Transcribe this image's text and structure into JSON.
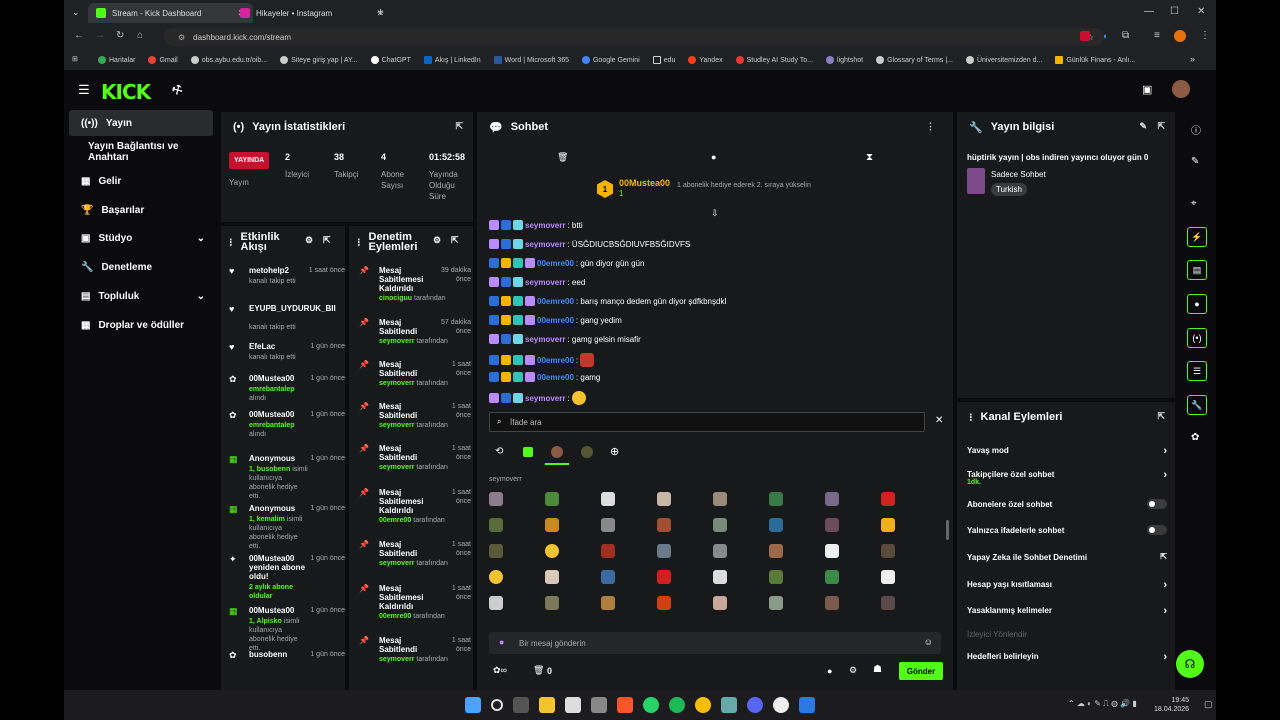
{
  "browser": {
    "tabs": [
      {
        "title": "Stream - Kick Dashboard",
        "active": true
      },
      {
        "title": "Hikayeler • Instagram",
        "active": false
      }
    ],
    "url": "dashboard.kick.com/stream",
    "bookmarks": [
      "Haritalar",
      "Gmail",
      "obs.aybu.edu.tr/oib...",
      "Siteye giriş yap | AY...",
      "ChatGPT",
      "Akış | LinkedIn",
      "Word | Microsoft 365",
      "Google Gemini",
      "edu",
      "Yandex",
      "Studley AI Study To...",
      "lightshot",
      "Glossary of Terms |...",
      "Üniversitemizden d...",
      "Günlük Finans - Anlı..."
    ]
  },
  "app": {
    "logo": "KICK",
    "sidebar": [
      {
        "label": "Yayın",
        "active": true
      },
      {
        "label": "Yayın Bağlantısı ve Anahtarı"
      },
      {
        "label": "Gelir"
      },
      {
        "label": "Başarılar"
      },
      {
        "label": "Stüdyo",
        "chevron": true
      },
      {
        "label": "Denetleme"
      },
      {
        "label": "Topluluk",
        "chevron": true
      },
      {
        "label": "Droplar ve ödüller"
      }
    ],
    "stats": {
      "title": "Yayın İstatistikleri",
      "live_badge": "YAYINDA",
      "live_label": "Yayın",
      "viewers_value": "2",
      "viewers_label": "İzleyici",
      "followers_value": "38",
      "followers_label": "Takipçi",
      "subs_value": "4",
      "subs_label": "Abone Sayısı",
      "duration_value": "01:52:58",
      "duration_label": "Yayında Olduğu Süre"
    },
    "activity": {
      "title": "Etkinlik Akışı",
      "items": [
        {
          "name": "metohelp2",
          "time": "1 saat önce",
          "desc": "kanalı takip etti"
        },
        {
          "name": "EYUPB_UYDURUK_BII",
          "time": "",
          "desc": "kanalı takip etti"
        },
        {
          "name": "EfeLac",
          "time": "1 gün önce",
          "desc": "kanalı takip etti"
        },
        {
          "name": "00Mustea00",
          "time": "1 gün önce",
          "green": "emrebantalep",
          "desc": "alındı"
        },
        {
          "name": "00Mustea00",
          "time": "1 gün önce",
          "green": "emrebantalep",
          "desc": "alındı"
        },
        {
          "name": "Anonymous",
          "time": "1 gün önce",
          "green": "1, busobenn",
          "desc": "isimli kullanıcıya abonelik hediye etti."
        },
        {
          "name": "Anonymous",
          "time": "1 gün önce",
          "green": "1, kemalim",
          "desc": "isimli kullanıcıya abonelik hediye etti."
        },
        {
          "name": "00Mustea00 yeniden abone oldu!",
          "time": "1 gün önce",
          "green": "2 aylık abone oldular",
          "desc": ""
        },
        {
          "name": "00Mustea00",
          "time": "1 gün önce",
          "green": "1, Alpisko",
          "desc": "isimli kullanıcıya abonelik hediye etti."
        },
        {
          "name": "busobenn",
          "time": "1 gün önce",
          "desc": ""
        }
      ]
    },
    "moderation": {
      "title": "Denetim Eylemleri",
      "by": "tarafından",
      "items": [
        {
          "action": "Mesaj Sabitlemesi Kaldırıldı",
          "time": "39 dakika önce",
          "user": "cinociguu"
        },
        {
          "action": "Mesaj Sabitlendi",
          "time": "57 dakika önce",
          "user": "seymoverr"
        },
        {
          "action": "Mesaj Sabitlendi",
          "time": "1 saat önce",
          "user": "seymoverr"
        },
        {
          "action": "Mesaj Sabitlendi",
          "time": "1 saat önce",
          "user": "seymoverr"
        },
        {
          "action": "Mesaj Sabitlendi",
          "time": "1 saat önce",
          "user": "seymoverr"
        },
        {
          "action": "Mesaj Sabitlemesi Kaldırıldı",
          "time": "1 saat önce",
          "user": "00emre00"
        },
        {
          "action": "Mesaj Sabitlendi",
          "time": "1 saat önce",
          "user": "seymoverr"
        },
        {
          "action": "Mesaj Sabitlemesi Kaldırıldı",
          "time": "1 saat önce",
          "user": "00emre00"
        },
        {
          "action": "Mesaj Sabitlendi",
          "time": "1 saat önce",
          "user": "seymoverr"
        }
      ]
    },
    "chat": {
      "title": "Sohbet",
      "gifter": "00Mustea00",
      "gifter_count": "1",
      "gift_text": "1 abonelik hediye ederek 2. sıraya yükselin",
      "rank": "1",
      "messages": [
        {
          "user": "seymoverr",
          "text": ": btti",
          "color": "purple"
        },
        {
          "user": "seymoverr",
          "text": ": ÜSĞDIUCBSĞDIUVFBSĞIDVFS",
          "color": "purple"
        },
        {
          "user": "00emre00",
          "text": ": gün diyor gün gün",
          "color": "blue"
        },
        {
          "user": "seymoverr",
          "text": ": eed",
          "color": "purple"
        },
        {
          "user": "00emre00",
          "text": ": barış manço dedem gün diyor şdfkbnşdkl",
          "color": "blue"
        },
        {
          "user": "00emre00",
          "text": ": gang yedim",
          "color": "blue"
        },
        {
          "user": "seymoverr",
          "text": ": gamg gelsin misafir",
          "color": "purple"
        },
        {
          "user": "00emre00",
          "text": ":",
          "color": "blue"
        },
        {
          "user": "00emre00",
          "text": ": gamg",
          "color": "blue"
        },
        {
          "user": "seymoverr",
          "text": ":",
          "color": "purple"
        }
      ],
      "emote_search_placeholder": "İfade ara",
      "emote_section": "seymoverr",
      "input_placeholder": "Bir mesaj gönderin",
      "points": "0",
      "send_label": "Gönder"
    },
    "stream_info": {
      "title": "Yayın bilgisi",
      "stream_title": "hüptirik yayın | obs indiren yayıncı oluyor gün 0",
      "category": "Sadece Sohbet",
      "language": "Turkish"
    },
    "channel_actions": {
      "title": "Kanal Eylemleri",
      "rows": [
        {
          "label": "Yavaş mod",
          "type": "chevron"
        },
        {
          "label": "Takipçilere özel sohbet",
          "type": "chevron",
          "sub": "1dk."
        },
        {
          "label": "Abonelere özel sohbet",
          "type": "toggle"
        },
        {
          "label": "Yalnızca ifadelerle sohbet",
          "type": "toggle"
        },
        {
          "label": "Yapay Zeka ile Sohbet Denetimi",
          "type": "external"
        },
        {
          "label": "Hesap yaşı kısıtlaması",
          "type": "chevron"
        },
        {
          "label": "Yasaklanmış kelimeler",
          "type": "chevron"
        },
        {
          "label": "İzleyici Yönlendir",
          "type": "disabled"
        },
        {
          "label": "Hedefleri belirleyin",
          "type": "chevron"
        }
      ]
    }
  },
  "taskbar": {
    "time": "19:45",
    "date": "18.04.2026"
  },
  "colors": {
    "accent": "#53fc18",
    "live": "#c8102e",
    "panel": "#18191b"
  }
}
